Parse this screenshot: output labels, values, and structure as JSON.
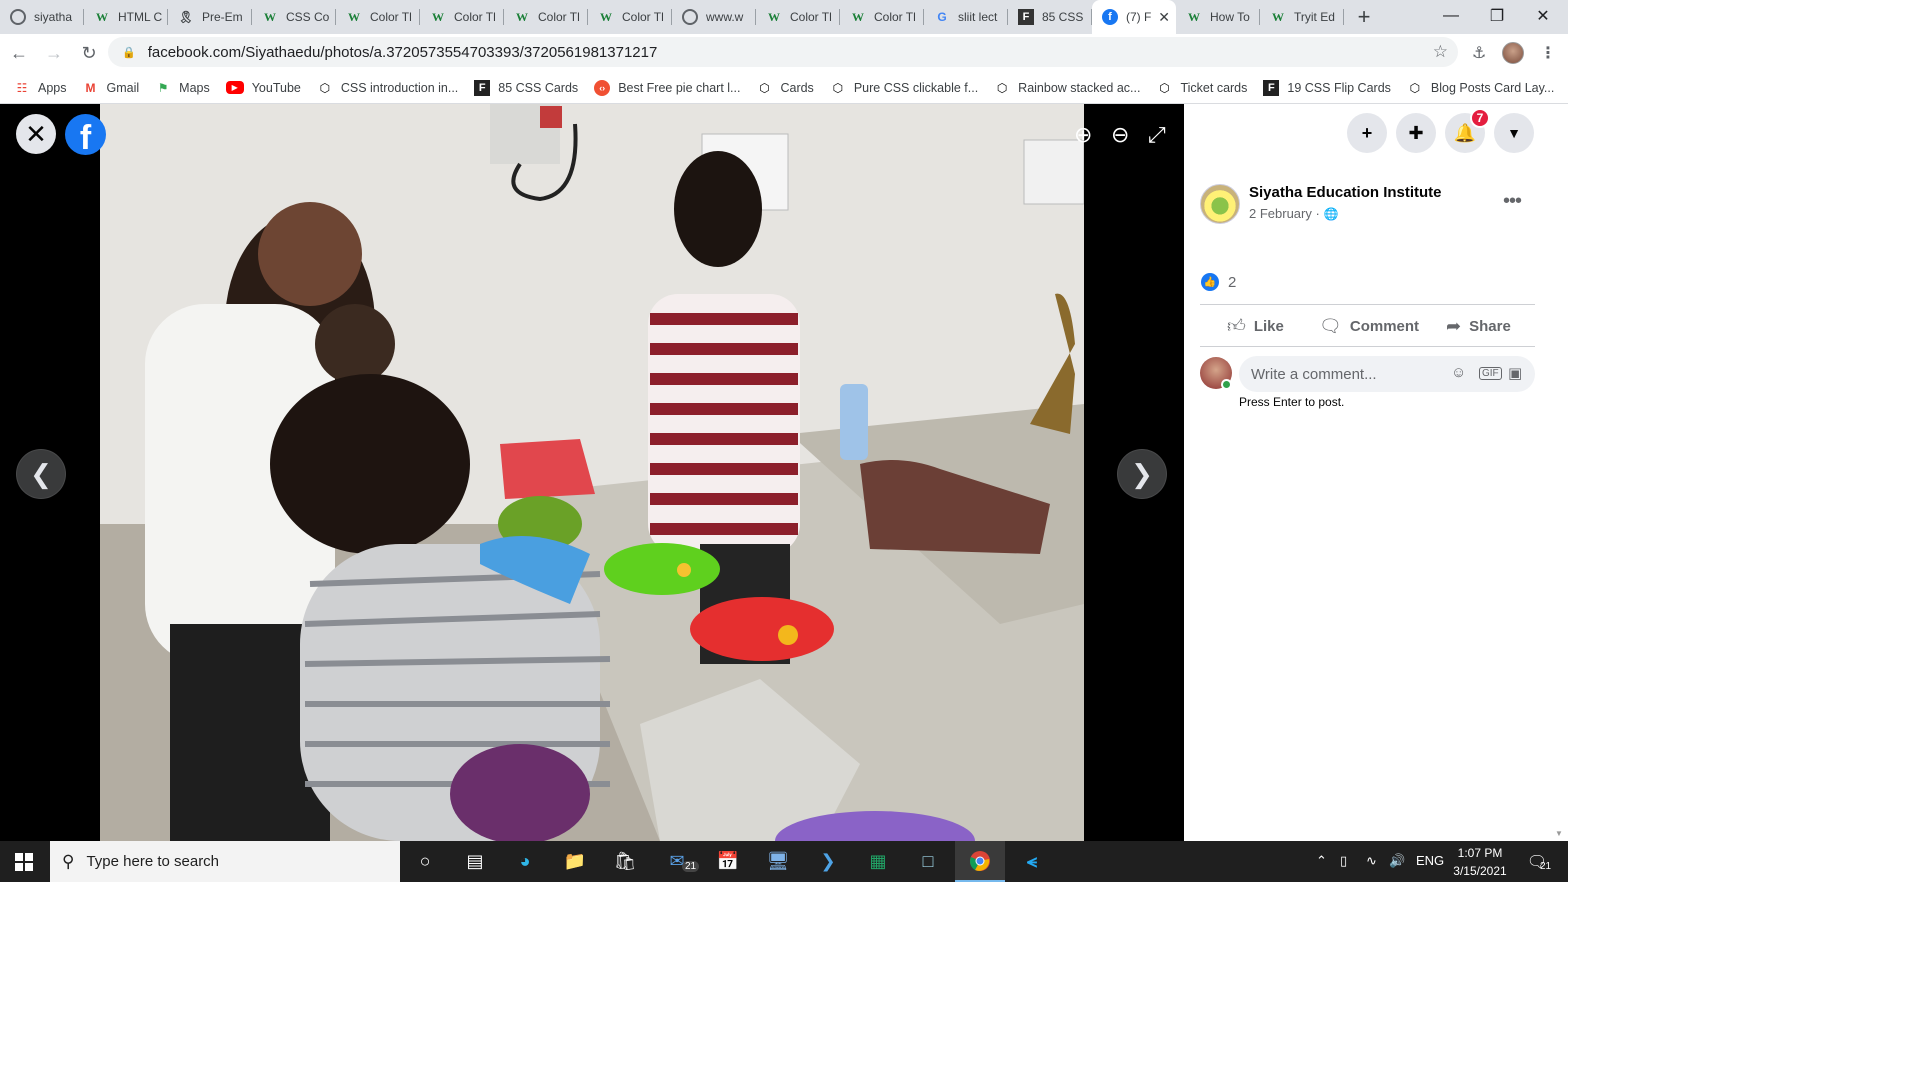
{
  "tabs": [
    {
      "label": "siyatha",
      "icon": "globe"
    },
    {
      "label": "HTML C",
      "icon": "w3schools"
    },
    {
      "label": "Pre-Em",
      "icon": "ribbon"
    },
    {
      "label": "CSS Col",
      "icon": "w3schools"
    },
    {
      "label": "Color Tl",
      "icon": "w3schools"
    },
    {
      "label": "Color Tl",
      "icon": "w3schools"
    },
    {
      "label": "Color Tl",
      "icon": "w3schools"
    },
    {
      "label": "Color Tl",
      "icon": "w3schools"
    },
    {
      "label": "www.w",
      "icon": "globe"
    },
    {
      "label": "Color Tl",
      "icon": "w3schools"
    },
    {
      "label": "Color Tl",
      "icon": "w3schools"
    },
    {
      "label": "sliit lect",
      "icon": "google"
    },
    {
      "label": "85 CSS",
      "icon": "f-square"
    },
    {
      "label": "(7) F",
      "icon": "facebook",
      "active": true
    },
    {
      "label": "How To",
      "icon": "w3schools"
    },
    {
      "label": "Tryit Ed",
      "icon": "w3schools"
    }
  ],
  "toolbar": {
    "url": "facebook.com/Siyathaedu/photos/a.3720573554703393/3720561981371217"
  },
  "bookmarks": [
    {
      "label": "Apps",
      "icon": "apps-grid",
      "color": "#ea4335"
    },
    {
      "label": "Gmail",
      "icon": "gmail",
      "color": "#ea4335"
    },
    {
      "label": "Maps",
      "icon": "maps",
      "color": "#34a853"
    },
    {
      "label": "YouTube",
      "icon": "youtube",
      "color": "#ff0000"
    },
    {
      "label": "CSS introduction in...",
      "icon": "codepen",
      "color": "#000000"
    },
    {
      "label": "85 CSS Cards",
      "icon": "f-square",
      "color": "#000000"
    },
    {
      "label": "Best Free pie chart l...",
      "icon": "code-circle",
      "color": "#f05033"
    },
    {
      "label": "Cards",
      "icon": "codepen",
      "color": "#000000"
    },
    {
      "label": "Pure CSS clickable f...",
      "icon": "codepen",
      "color": "#000000"
    },
    {
      "label": "Rainbow stacked ac...",
      "icon": "codepen",
      "color": "#000000"
    },
    {
      "label": "Ticket cards",
      "icon": "codepen",
      "color": "#000000"
    },
    {
      "label": "19 CSS Flip Cards",
      "icon": "f-square",
      "color": "#000000"
    },
    {
      "label": "Blog Posts Card Lay...",
      "icon": "codepen",
      "color": "#000000"
    }
  ],
  "header": {
    "notification_count": "7"
  },
  "post": {
    "page_name": "Siyatha Education Institute",
    "date": "2 February ·",
    "like_count": "2",
    "actions": {
      "like": "Like",
      "comment": "Comment",
      "share": "Share"
    },
    "comment_placeholder": "Write a comment...",
    "press_enter": "Press Enter to post."
  },
  "taskbar": {
    "search_placeholder": "Type here to search",
    "mail_badge": "21",
    "language": "ENG",
    "time": "1:07 PM",
    "date": "3/15/2021",
    "notification_count": "21"
  },
  "colors": {
    "facebook_blue": "#1877f2",
    "badge_red": "#e41e3f",
    "taskbar": "#1f1f1f"
  }
}
